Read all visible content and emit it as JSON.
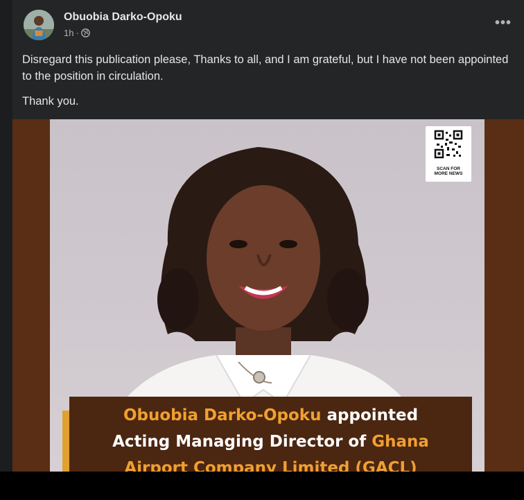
{
  "post": {
    "author": "Obuobia Darko-Opoku",
    "time": "1h",
    "separator": "·",
    "more_label": "•••",
    "paragraphs": [
      "Disregard this publication please, Thanks to all, and I am grateful, but I have not been appointed to the position in circulation.",
      "Thank you."
    ]
  },
  "image": {
    "qr_caption_line1": "SCAN FOR",
    "qr_caption_line2": "MORE NEWS",
    "headline_name": "Obuobia Darko-Opoku",
    "headline_part2": " appointed",
    "headline_line2_a": "Acting Managing Director of ",
    "headline_line2_b": "Ghana",
    "headline_line3": "Airport Company Limited (GACL)"
  },
  "icons": [
    "globe-icon",
    "more-options-icon",
    "qr-code-icon"
  ],
  "colors": {
    "background": "#1c1d1f",
    "card": "#242526",
    "text": "#e4e6eb",
    "muted": "#b0b3b8",
    "frame_brown": "#5a2e14",
    "banner_brown": "#4b2611",
    "accent_orange": "#f0a030"
  }
}
